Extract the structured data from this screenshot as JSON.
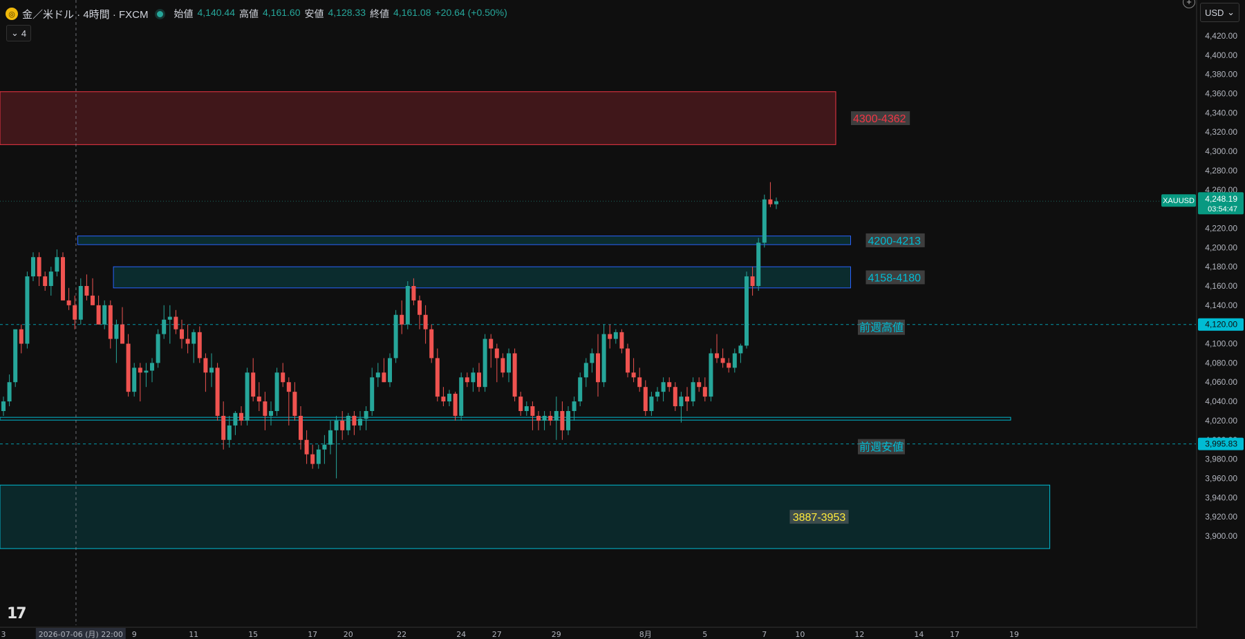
{
  "header": {
    "symbol_title": "金／米ドル · 4時間 · FXCM",
    "open_label": "始値",
    "open": "4,140.44",
    "high_label": "高値",
    "high": "4,161.60",
    "low_label": "安値",
    "low": "4,128.33",
    "close_label": "終値",
    "close": "4,161.08",
    "change": "+20.64 (+0.50%)",
    "indicator_count": "4"
  },
  "currency_selector": "USD",
  "colors": {
    "up": "#26a69a",
    "down": "#ef5350",
    "background": "#0f0f0f",
    "resistance": "#f23645",
    "support": "#2962ff",
    "accent": "#00bcd4"
  },
  "chart_data": {
    "type": "candlestick",
    "symbol": "XAUUSD",
    "timeframe": "4h",
    "ylim": [
      3880,
      4440
    ],
    "y_ticks": [
      3900,
      3920,
      3940,
      3960,
      3980,
      4000,
      4020,
      4040,
      4060,
      4080,
      4100,
      4120,
      4140,
      4160,
      4180,
      4200,
      4220,
      4240,
      4260,
      4280,
      4300,
      4320,
      4340,
      4360,
      4380,
      4400,
      4420
    ],
    "x_ticks": [
      {
        "label": "3",
        "i": 0
      },
      {
        "label": "2026-07-06 (月)  22:00",
        "i": 13
      },
      {
        "label": "9",
        "i": 22
      },
      {
        "label": "11",
        "i": 32
      },
      {
        "label": "15",
        "i": 42
      },
      {
        "label": "17",
        "i": 52
      },
      {
        "label": "20",
        "i": 58
      },
      {
        "label": "22",
        "i": 67
      },
      {
        "label": "24",
        "i": 77
      },
      {
        "label": "27",
        "i": 83
      },
      {
        "label": "29",
        "i": 93
      },
      {
        "label": "8月",
        "i": 108
      },
      {
        "label": "5",
        "i": 118
      },
      {
        "label": "7",
        "i": 128
      },
      {
        "label": "10",
        "i": 134
      },
      {
        "label": "12",
        "i": 144
      },
      {
        "label": "14",
        "i": 154
      },
      {
        "label": "17",
        "i": 160
      },
      {
        "label": "19",
        "i": 170
      }
    ],
    "last_price": {
      "symbol_label": "XAUUSD",
      "price": "4,248.19",
      "value": 4248.19,
      "countdown": "03:54:47"
    },
    "price_labels": [
      {
        "label": "4,120.00",
        "value": 4120
      },
      {
        "label": "3,995.83",
        "value": 3995.83
      }
    ],
    "zones": [
      {
        "label": "4300-4362",
        "top": 4362,
        "bottom": 4307,
        "i_start": -1,
        "i_end": 140,
        "kind": "resistance"
      },
      {
        "label": "4200-4213",
        "top": 4212,
        "bottom": 4203,
        "i_start": 12.5,
        "i_end": 142.5,
        "kind": "support"
      },
      {
        "label": "4158-4180",
        "top": 4180,
        "bottom": 4158,
        "i_start": 18.5,
        "i_end": 142.5,
        "kind": "support"
      },
      {
        "label": "3887-3953",
        "top": 3953,
        "bottom": 3887,
        "i_start": -1,
        "i_end": 176,
        "kind": "demand"
      }
    ],
    "lines": [
      {
        "label": "前週高値",
        "value": 4120,
        "style": "dashed"
      },
      {
        "label": "前週安値",
        "value": 3995.83,
        "style": "dashed"
      },
      {
        "label": "",
        "value": 4022,
        "style": "double"
      }
    ],
    "crosshair_i": 12.2,
    "candles": [
      [
        4030,
        4045,
        4025,
        4040
      ],
      [
        4040,
        4068,
        4035,
        4060
      ],
      [
        4060,
        4090,
        4055,
        4115
      ],
      [
        4115,
        4120,
        4090,
        4100
      ],
      [
        4100,
        4175,
        4095,
        4170
      ],
      [
        4170,
        4195,
        4165,
        4190
      ],
      [
        4190,
        4195,
        4160,
        4170
      ],
      [
        4170,
        4175,
        4155,
        4160
      ],
      [
        4160,
        4180,
        4150,
        4175
      ],
      [
        4175,
        4198,
        4170,
        4190
      ],
      [
        4190,
        4195,
        4160,
        4145
      ],
      [
        4145,
        4158,
        4135,
        4140
      ],
      [
        4140,
        4150,
        4115,
        4125
      ],
      [
        4125,
        4168,
        4120,
        4160
      ],
      [
        4160,
        4172,
        4145,
        4150
      ],
      [
        4150,
        4168,
        4140,
        4140
      ],
      [
        4140,
        4150,
        4120,
        4120
      ],
      [
        4120,
        4145,
        4115,
        4140
      ],
      [
        4140,
        4145,
        4095,
        4105
      ],
      [
        4105,
        4125,
        4080,
        4120
      ],
      [
        4120,
        4138,
        4100,
        4100
      ],
      [
        4100,
        4110,
        4045,
        4050
      ],
      [
        4050,
        4080,
        4045,
        4075
      ],
      [
        4075,
        4080,
        4040,
        4070
      ],
      [
        4070,
        4080,
        4055,
        4072
      ],
      [
        4072,
        4085,
        4060,
        4080
      ],
      [
        4080,
        4115,
        4075,
        4110
      ],
      [
        4110,
        4140,
        4105,
        4125
      ],
      [
        4125,
        4140,
        4100,
        4128
      ],
      [
        4128,
        4135,
        4110,
        4115
      ],
      [
        4115,
        4125,
        4095,
        4105
      ],
      [
        4105,
        4120,
        4090,
        4100
      ],
      [
        4100,
        4115,
        4080,
        4112
      ],
      [
        4112,
        4118,
        4080,
        4085
      ],
      [
        4085,
        4090,
        4050,
        4070
      ],
      [
        4070,
        4090,
        4055,
        4075
      ],
      [
        4075,
        4080,
        4020,
        4025
      ],
      [
        4025,
        4040,
        3990,
        4000
      ],
      [
        4000,
        4025,
        3992,
        4015
      ],
      [
        4015,
        4030,
        4005,
        4028
      ],
      [
        4028,
        4035,
        4015,
        4020
      ],
      [
        4020,
        4075,
        4015,
        4070
      ],
      [
        4070,
        4085,
        4040,
        4045
      ],
      [
        4045,
        4060,
        4030,
        4040
      ],
      [
        4040,
        4050,
        4010,
        4025
      ],
      [
        4025,
        4040,
        4015,
        4030
      ],
      [
        4030,
        4075,
        4025,
        4070
      ],
      [
        4070,
        4080,
        4055,
        4060
      ],
      [
        4060,
        4065,
        4015,
        4050
      ],
      [
        4050,
        4060,
        4020,
        4025
      ],
      [
        4025,
        4035,
        3990,
        4000
      ],
      [
        4000,
        4010,
        3975,
        3985
      ],
      [
        3985,
        3995,
        3970,
        3975
      ],
      [
        3975,
        3995,
        3970,
        3990
      ],
      [
        3990,
        4005,
        3975,
        3995
      ],
      [
        3995,
        4020,
        3985,
        4010
      ],
      [
        4010,
        4025,
        3960,
        4020
      ],
      [
        4020,
        4030,
        4000,
        4010
      ],
      [
        4010,
        4028,
        4005,
        4025
      ],
      [
        4025,
        4030,
        4005,
        4015
      ],
      [
        4015,
        4030,
        4010,
        4022
      ],
      [
        4022,
        4035,
        4010,
        4030
      ],
      [
        4030,
        4075,
        4025,
        4065
      ],
      [
        4065,
        4080,
        4055,
        4070
      ],
      [
        4070,
        4085,
        4060,
        4060
      ],
      [
        4060,
        4090,
        4055,
        4085
      ],
      [
        4085,
        4135,
        4080,
        4130
      ],
      [
        4130,
        4145,
        4110,
        4120
      ],
      [
        4120,
        4165,
        4115,
        4160
      ],
      [
        4160,
        4168,
        4140,
        4145
      ],
      [
        4145,
        4150,
        4115,
        4130
      ],
      [
        4130,
        4140,
        4100,
        4115
      ],
      [
        4115,
        4120,
        4080,
        4085
      ],
      [
        4085,
        4095,
        4040,
        4045
      ],
      [
        4045,
        4055,
        4035,
        4040
      ],
      [
        4040,
        4052,
        4035,
        4048
      ],
      [
        4048,
        4050,
        4020,
        4025
      ],
      [
        4025,
        4070,
        4020,
        4065
      ],
      [
        4065,
        4070,
        4055,
        4060
      ],
      [
        4060,
        4075,
        4050,
        4070
      ],
      [
        4070,
        4080,
        4050,
        4055
      ],
      [
        4055,
        4110,
        4050,
        4105
      ],
      [
        4105,
        4110,
        4075,
        4095
      ],
      [
        4095,
        4100,
        4060,
        4085
      ],
      [
        4085,
        4090,
        4065,
        4070
      ],
      [
        4070,
        4095,
        4060,
        4090
      ],
      [
        4090,
        4095,
        4040,
        4045
      ],
      [
        4045,
        4050,
        4025,
        4030
      ],
      [
        4030,
        4040,
        4025,
        4035
      ],
      [
        4035,
        4040,
        4010,
        4025
      ],
      [
        4025,
        4030,
        4010,
        4020
      ],
      [
        4020,
        4030,
        4010,
        4025
      ],
      [
        4025,
        4030,
        4015,
        4020
      ],
      [
        4020,
        4045,
        4000,
        4030
      ],
      [
        4030,
        4040,
        4000,
        4010
      ],
      [
        4010,
        4035,
        4005,
        4030
      ],
      [
        4030,
        4045,
        4020,
        4040
      ],
      [
        4040,
        4070,
        4035,
        4065
      ],
      [
        4065,
        4085,
        4055,
        4080
      ],
      [
        4080,
        4095,
        4070,
        4090
      ],
      [
        4090,
        4110,
        4045,
        4060
      ],
      [
        4060,
        4120,
        4055,
        4110
      ],
      [
        4110,
        4120,
        4095,
        4105
      ],
      [
        4105,
        4115,
        4100,
        4112
      ],
      [
        4112,
        4115,
        4090,
        4095
      ],
      [
        4095,
        4100,
        4065,
        4070
      ],
      [
        4070,
        4085,
        4060,
        4065
      ],
      [
        4065,
        4075,
        4050,
        4055
      ],
      [
        4055,
        4062,
        4025,
        4030
      ],
      [
        4030,
        4050,
        4025,
        4045
      ],
      [
        4045,
        4055,
        4040,
        4050
      ],
      [
        4050,
        4065,
        4040,
        4060
      ],
      [
        4060,
        4065,
        4050,
        4055
      ],
      [
        4055,
        4060,
        4030,
        4035
      ],
      [
        4035,
        4050,
        4018,
        4045
      ],
      [
        4045,
        4055,
        4030,
        4040
      ],
      [
        4040,
        4065,
        4035,
        4060
      ],
      [
        4060,
        4065,
        4050,
        4055
      ],
      [
        4055,
        4065,
        4040,
        4045
      ],
      [
        4045,
        4095,
        4040,
        4090
      ],
      [
        4090,
        4110,
        4080,
        4085
      ],
      [
        4085,
        4095,
        4075,
        4080
      ],
      [
        4080,
        4085,
        4070,
        4075
      ],
      [
        4075,
        4095,
        4070,
        4090
      ],
      [
        4090,
        4100,
        4080,
        4098
      ],
      [
        4098,
        4175,
        4095,
        4170
      ],
      [
        4170,
        4180,
        4150,
        4160
      ],
      [
        4160,
        4210,
        4155,
        4205
      ],
      [
        4205,
        4255,
        4200,
        4250
      ],
      [
        4250,
        4268,
        4242,
        4245
      ],
      [
        4245,
        4252,
        4240,
        4248
      ]
    ]
  }
}
